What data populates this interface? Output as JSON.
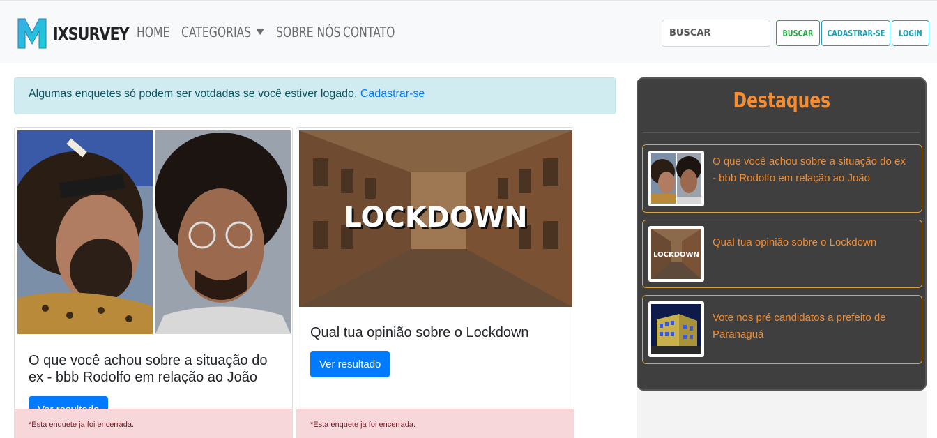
{
  "navbar": {
    "brand": "IXSURVEY",
    "links": [
      "HOME",
      "CATEGORIAS",
      "SOBRE NÓS",
      "CONTATO"
    ],
    "search_placeholder": "BUSCAR",
    "buscar_label": "BUSCAR",
    "cadastrar_label": "CADASTRAR-SE",
    "login_label": "LOGIN"
  },
  "alert": {
    "text": "Algumas enquetes só podem ser votdadas se você estiver logado.",
    "link": "Cadastrar-se"
  },
  "cards": [
    {
      "title": "O que você achou sobre a situação do ex - bbb Rodolfo em relação ao João",
      "button": "Ver resultado",
      "closed_note": "*Esta enquete ja foi encerrada."
    },
    {
      "title": "Qual tua opinião sobre o Lockdown",
      "image_text": "LOCKDOWN",
      "button": "Ver resultado",
      "closed_note": "*Esta enquete ja foi encerrada."
    }
  ],
  "sidebar": {
    "title": "Destaques",
    "items": [
      {
        "text": "O que você achou sobre a situação do ex - bbb Rodolfo em relação ao João"
      },
      {
        "text": "Qual tua opinião sobre o Lockdown",
        "thumb_text": "LOCKDOWN"
      },
      {
        "text": "Vote nos pré candidatos a prefeito de Paranaguá"
      }
    ]
  },
  "colors": {
    "accent_orange": "#f58c2f",
    "primary_blue": "#007bff",
    "success_green": "#28a745",
    "info_teal": "#17a2b8"
  }
}
